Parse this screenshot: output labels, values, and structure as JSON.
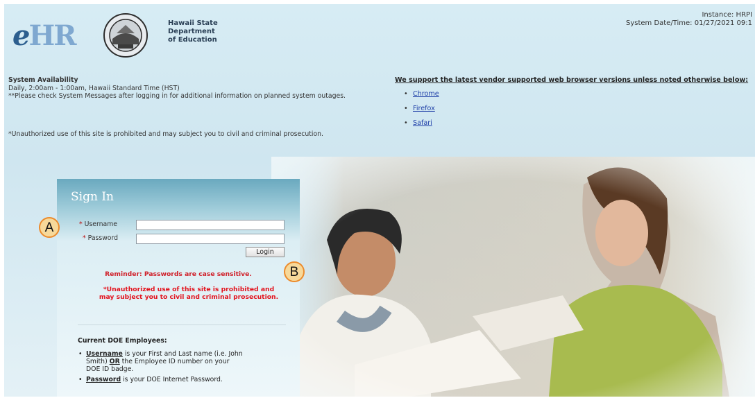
{
  "header": {
    "logo_e": "e",
    "logo_hr": "HR",
    "dept_line1": "Hawaii State",
    "dept_line2": "Department",
    "dept_line3": "of Education",
    "instance": "Instance: HRPI",
    "system_datetime": "System Date/Time: 01/27/2021 09:1"
  },
  "availability": {
    "title": "System Availability",
    "line1": "Daily, 2:00am - 1:00am, Hawaii Standard Time (HST)",
    "line2": "**Please check System Messages after logging in for additional information on planned system outages.",
    "unauthorized": "*Unauthorized use of this site is prohibited and may subject you to civil and criminal prosecution."
  },
  "browsers": {
    "header": "We support the latest vendor supported web browser versions unless noted otherwise below:",
    "items": [
      "Chrome",
      "Firefox",
      "Safari"
    ]
  },
  "signin": {
    "title": "Sign In",
    "username_label": "Username",
    "password_label": "Password",
    "username_value": "",
    "password_value": "",
    "login_label": "Login",
    "reminder": "Reminder: Passwords are case sensitive.",
    "warning": "*Unauthorized use of this site is prohibited and may subject you to civil and criminal prosecution."
  },
  "employees": {
    "heading": "Current DOE Employees:",
    "username_term": "Username",
    "username_text_a": " is your First and Last name (i.e. John Smith) ",
    "username_or": "OR",
    "username_text_b": " the Employee ID number on your DOE ID badge.",
    "password_term": "Password",
    "password_text": " is your DOE Internet Password."
  },
  "callouts": {
    "a": "A",
    "b": "B"
  },
  "colors": {
    "background": "#d7ecf4",
    "panel_header": "#6aa9bf",
    "warning_red": "#e3141f",
    "link": "#1f3fa8",
    "callout_fill": "#f7d99a",
    "callout_border": "#ec8b2c"
  }
}
